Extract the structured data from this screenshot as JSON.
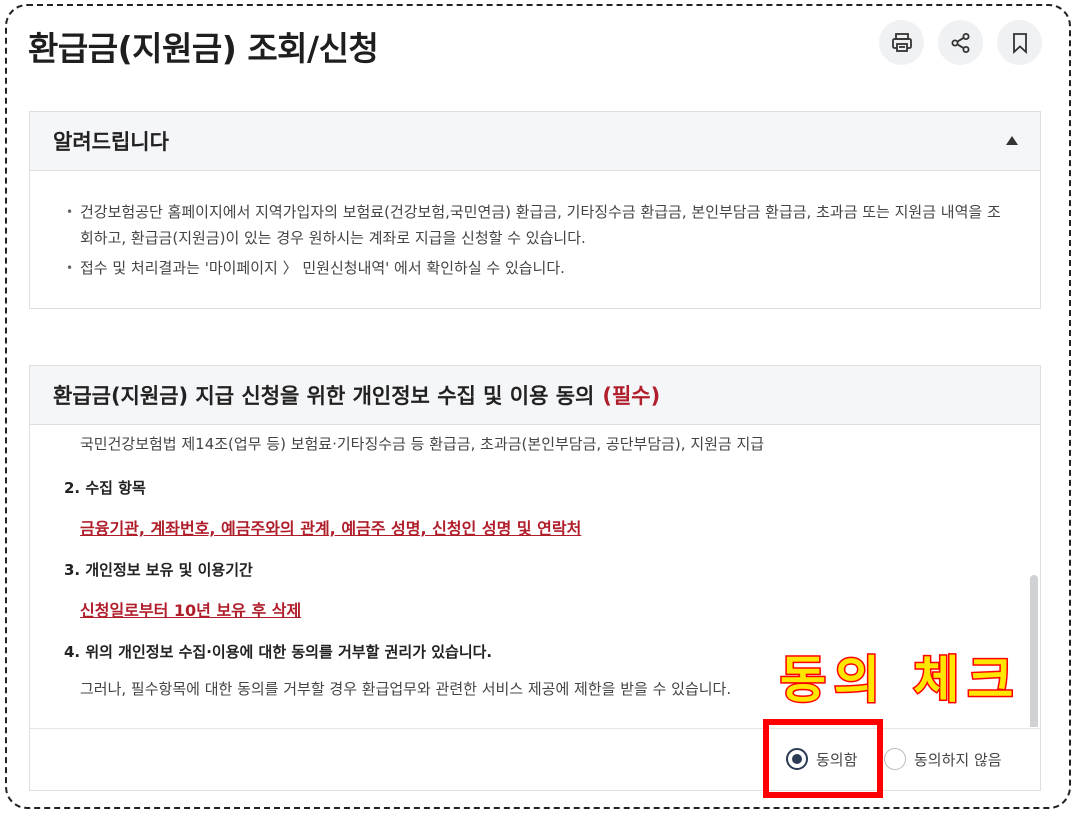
{
  "page": {
    "title": "환급금(지원금) 조회/신청",
    "actions": [
      {
        "icon": "printer-icon",
        "label": "print"
      },
      {
        "icon": "share-icon",
        "label": "share"
      },
      {
        "icon": "bookmark-icon",
        "label": "bookmark"
      }
    ]
  },
  "notice": {
    "title": "알려드립니다",
    "items": [
      "건강보험공단 홈페이지에서 지역가입자의 보험료(건강보험,국민연금) 환급금, 기타징수금 환급금, 본인부담금 환급금, 초과금 또는 지원금 내역을 조회하고, 환급금(지원금)이 있는 경우 원하시는 계좌로 지급을 신청할 수 있습니다.",
      "접수 및 처리결과는 '마이페이지 〉 민원신청내역' 에서 확인하실 수 있습니다."
    ]
  },
  "consent": {
    "title": "환급금(지원금) 지급 신청을 위한 개인정보 수집 및 이용 동의",
    "required_label": "(필수)",
    "purpose_text": "국민건강보험법 제14조(업무 등) 보험료·기타징수금 등 환급금, 초과금(본인부담금, 공단부담금), 지원금 지급",
    "section2_title": "2. 수집 항목",
    "section2_value": "금융기관, 계좌번호, 예금주와의 관계, 예금주 성명, 신청인 성명 및 연락처",
    "section3_title": "3. 개인정보 보유 및 이용기간",
    "section3_value": "신청일로부터 10년 보유 후 삭제",
    "section4_title": "4. 위의 개인정보 수집·이용에 대한 동의를 거부할 권리가 있습니다.",
    "section4_text": "그러나, 필수항목에 대한 동의를 거부할 경우 환급업무와 관련한 서비스 제공에 제한을 받을 수 있습니다.",
    "agree_label": "동의함",
    "disagree_label": "동의하지 않음",
    "selected": "agree"
  },
  "annotation": {
    "text": "동의 체크",
    "color_fill": "#ffe600",
    "color_stroke": "#ff0000"
  }
}
